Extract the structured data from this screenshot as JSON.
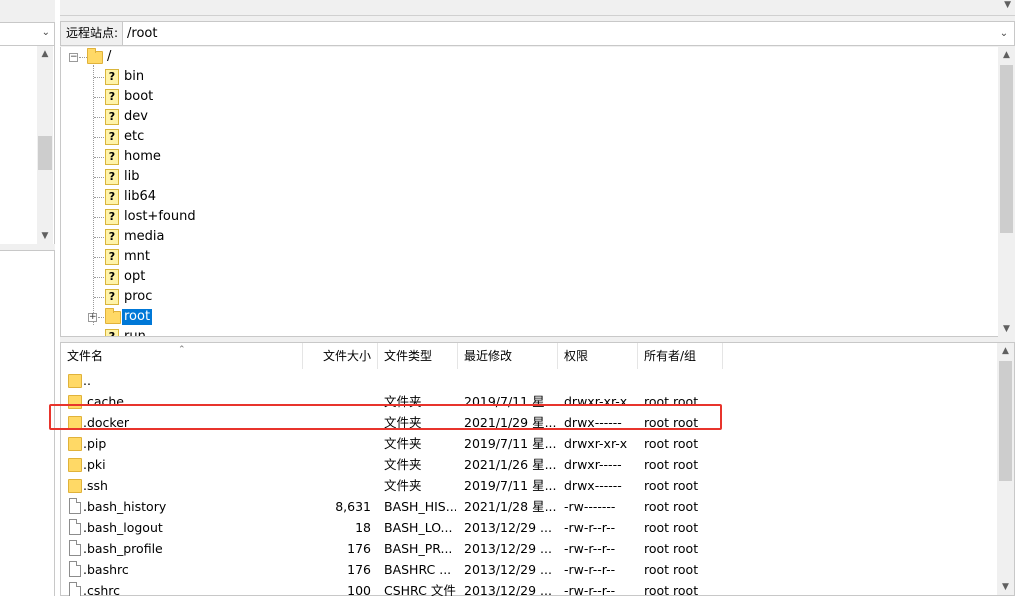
{
  "remote": {
    "site_label": "远程站点:",
    "path": "/root"
  },
  "tree": {
    "root_label": "/",
    "items": [
      "bin",
      "boot",
      "dev",
      "etc",
      "home",
      "lib",
      "lib64",
      "lost+found",
      "media",
      "mnt",
      "opt",
      "proc",
      "root",
      "run"
    ],
    "selected": "root"
  },
  "file_list": {
    "columns": {
      "name": "文件名",
      "size": "文件大小",
      "type": "文件类型",
      "modified": "最近修改",
      "permissions": "权限",
      "owner": "所有者/组"
    },
    "rows": [
      {
        "name": "..",
        "size": "",
        "type": "",
        "modified": "",
        "perms": "",
        "owner": "",
        "kind": "folder"
      },
      {
        "name": ".cache",
        "size": "",
        "type": "文件夹",
        "modified": "2019/7/11 星...",
        "perms": "drwxr-xr-x",
        "owner": "root root",
        "kind": "folder"
      },
      {
        "name": ".docker",
        "size": "",
        "type": "文件夹",
        "modified": "2021/1/29 星...",
        "perms": "drwx------",
        "owner": "root root",
        "kind": "folder"
      },
      {
        "name": ".pip",
        "size": "",
        "type": "文件夹",
        "modified": "2019/7/11 星...",
        "perms": "drwxr-xr-x",
        "owner": "root root",
        "kind": "folder"
      },
      {
        "name": ".pki",
        "size": "",
        "type": "文件夹",
        "modified": "2021/1/26 星...",
        "perms": "drwxr-----",
        "owner": "root root",
        "kind": "folder"
      },
      {
        "name": ".ssh",
        "size": "",
        "type": "文件夹",
        "modified": "2019/7/11 星...",
        "perms": "drwx------",
        "owner": "root root",
        "kind": "folder"
      },
      {
        "name": ".bash_history",
        "size": "8,631",
        "type": "BASH_HIS...",
        "modified": "2021/1/28 星...",
        "perms": "-rw-------",
        "owner": "root root",
        "kind": "file"
      },
      {
        "name": ".bash_logout",
        "size": "18",
        "type": "BASH_LO...",
        "modified": "2013/12/29 ...",
        "perms": "-rw-r--r--",
        "owner": "root root",
        "kind": "file"
      },
      {
        "name": ".bash_profile",
        "size": "176",
        "type": "BASH_PR...",
        "modified": "2013/12/29 ...",
        "perms": "-rw-r--r--",
        "owner": "root root",
        "kind": "file"
      },
      {
        "name": ".bashrc",
        "size": "176",
        "type": "BASHRC ...",
        "modified": "2013/12/29 ...",
        "perms": "-rw-r--r--",
        "owner": "root root",
        "kind": "file"
      },
      {
        "name": ".cshrc",
        "size": "100",
        "type": "CSHRC 文件",
        "modified": "2013/12/29 ...",
        "perms": "-rw-r--r--",
        "owner": "root root",
        "kind": "file"
      }
    ]
  },
  "colors": {
    "selection": "#0078d7",
    "highlight_box": "#e8342c",
    "folder": "#ffd966"
  }
}
